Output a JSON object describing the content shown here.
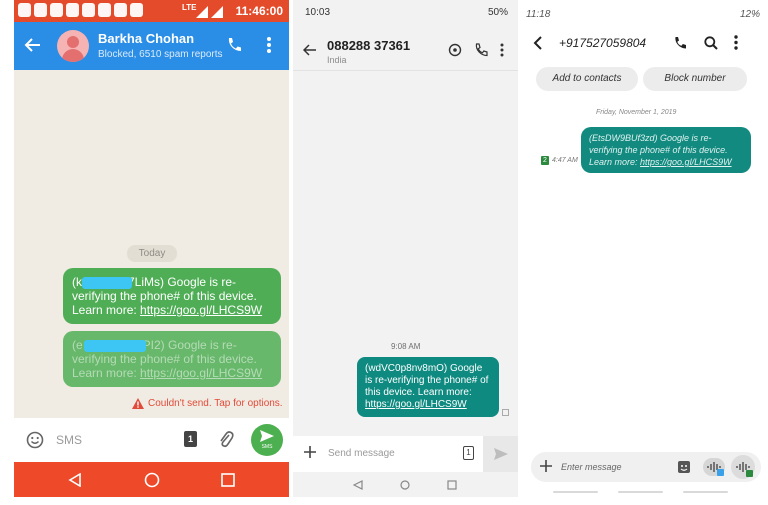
{
  "panel1": {
    "status_time": "11:46:00",
    "status_network": "LTE",
    "contact_name": "Barkha Chohan",
    "contact_sub": "Blocked, 6510 spam reports",
    "date_chip": "Today",
    "msg1": {
      "prefix": "(k",
      "code_tail": "7LiMs)",
      "body": " Google is re-verifying the phone# of this device. Learn more: ",
      "link": "https://goo.gl/LHCS9W"
    },
    "msg2": {
      "prefix": "(e",
      "code_tail": "PI2)",
      "body": " Google is re-verifying the phone# of this device. Learn more: ",
      "link": "https://goo.gl/LHCS9W"
    },
    "send_failed": "Couldn't send. Tap for options.",
    "compose_placeholder": "SMS",
    "sim_label": "1",
    "send_label": "SMS",
    "colors": {
      "appbar": "#2a8ee6",
      "status": "#e34b2b",
      "bubble": "#4fae55",
      "navbar": "#ee4a2a"
    }
  },
  "panel2": {
    "status_time": "10:03",
    "battery": "50%",
    "phone_number": "088288 37361",
    "country": "India",
    "msg_time": "9:08 AM",
    "message": "(wdVC0p8nv8mO) Google is re-verifying the phone# of this device. Learn more: ",
    "link": "https://goo.gl/LHCS9W",
    "compose_placeholder": "Send message",
    "sim_label": "1",
    "colors": {
      "bubble": "#0f8a80"
    }
  },
  "panel3": {
    "status_time": "11:18",
    "battery": "12%",
    "phone_number": "+917527059804",
    "add_contacts": "Add to contacts",
    "block_number": "Block number",
    "date_label": "Friday, November 1, 2019",
    "message": "(EtsDW9BUf3zd) Google is re-verifying the phone# of this device. Learn more: ",
    "link": "https://goo.gl/LHCS9W",
    "msg_time": "4:47 AM",
    "sim_label": "2",
    "compose_placeholder": "Enter message",
    "colors": {
      "bubble": "#128a80"
    }
  }
}
